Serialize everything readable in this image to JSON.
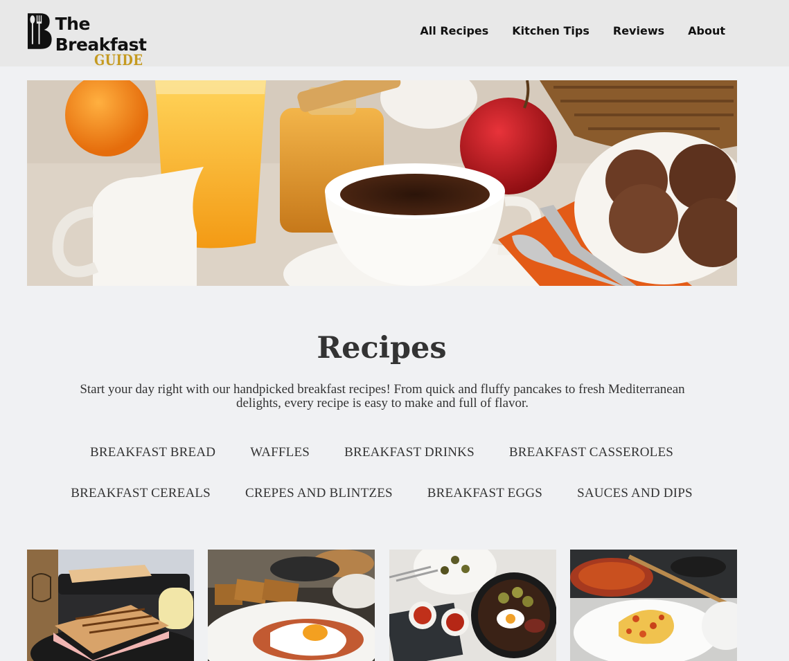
{
  "header": {
    "logo": {
      "line1": "The Breakfast",
      "line2": "GUIDE"
    },
    "nav": [
      "All Recipes",
      "Kitchen Tips",
      "Reviews",
      "About"
    ]
  },
  "hero": {
    "image": "breakfast-table-photo"
  },
  "main": {
    "title": "Recipes",
    "intro": "Start your day right with our handpicked breakfast recipes! From quick and fluffy pancakes to fresh Mediterranean delights, every recipe is easy to make and full of flavor.",
    "categories_row1": [
      "BREAKFAST BREAD",
      "WAFFLES",
      "BREAKFAST DRINKS",
      "BREAKFAST CASSEROLES"
    ],
    "categories_row2": [
      "BREAKFAST CEREALS",
      "CREPES AND BLINTZES",
      "BREAKFAST EGGS",
      "SAUCES AND DIPS"
    ]
  },
  "colors": {
    "header_bg": "#e8e8e8",
    "page_bg": "#f0f1f3",
    "logo_accent": "#c59a20",
    "text": "#333333"
  },
  "cards": [
    {
      "image": "grilled-ham-sandwich-photo"
    },
    {
      "image": "fried-egg-toast-photo"
    },
    {
      "image": "skillet-eggs-potatoes-photo"
    },
    {
      "image": "scrambled-eggs-tomato-photo"
    }
  ]
}
